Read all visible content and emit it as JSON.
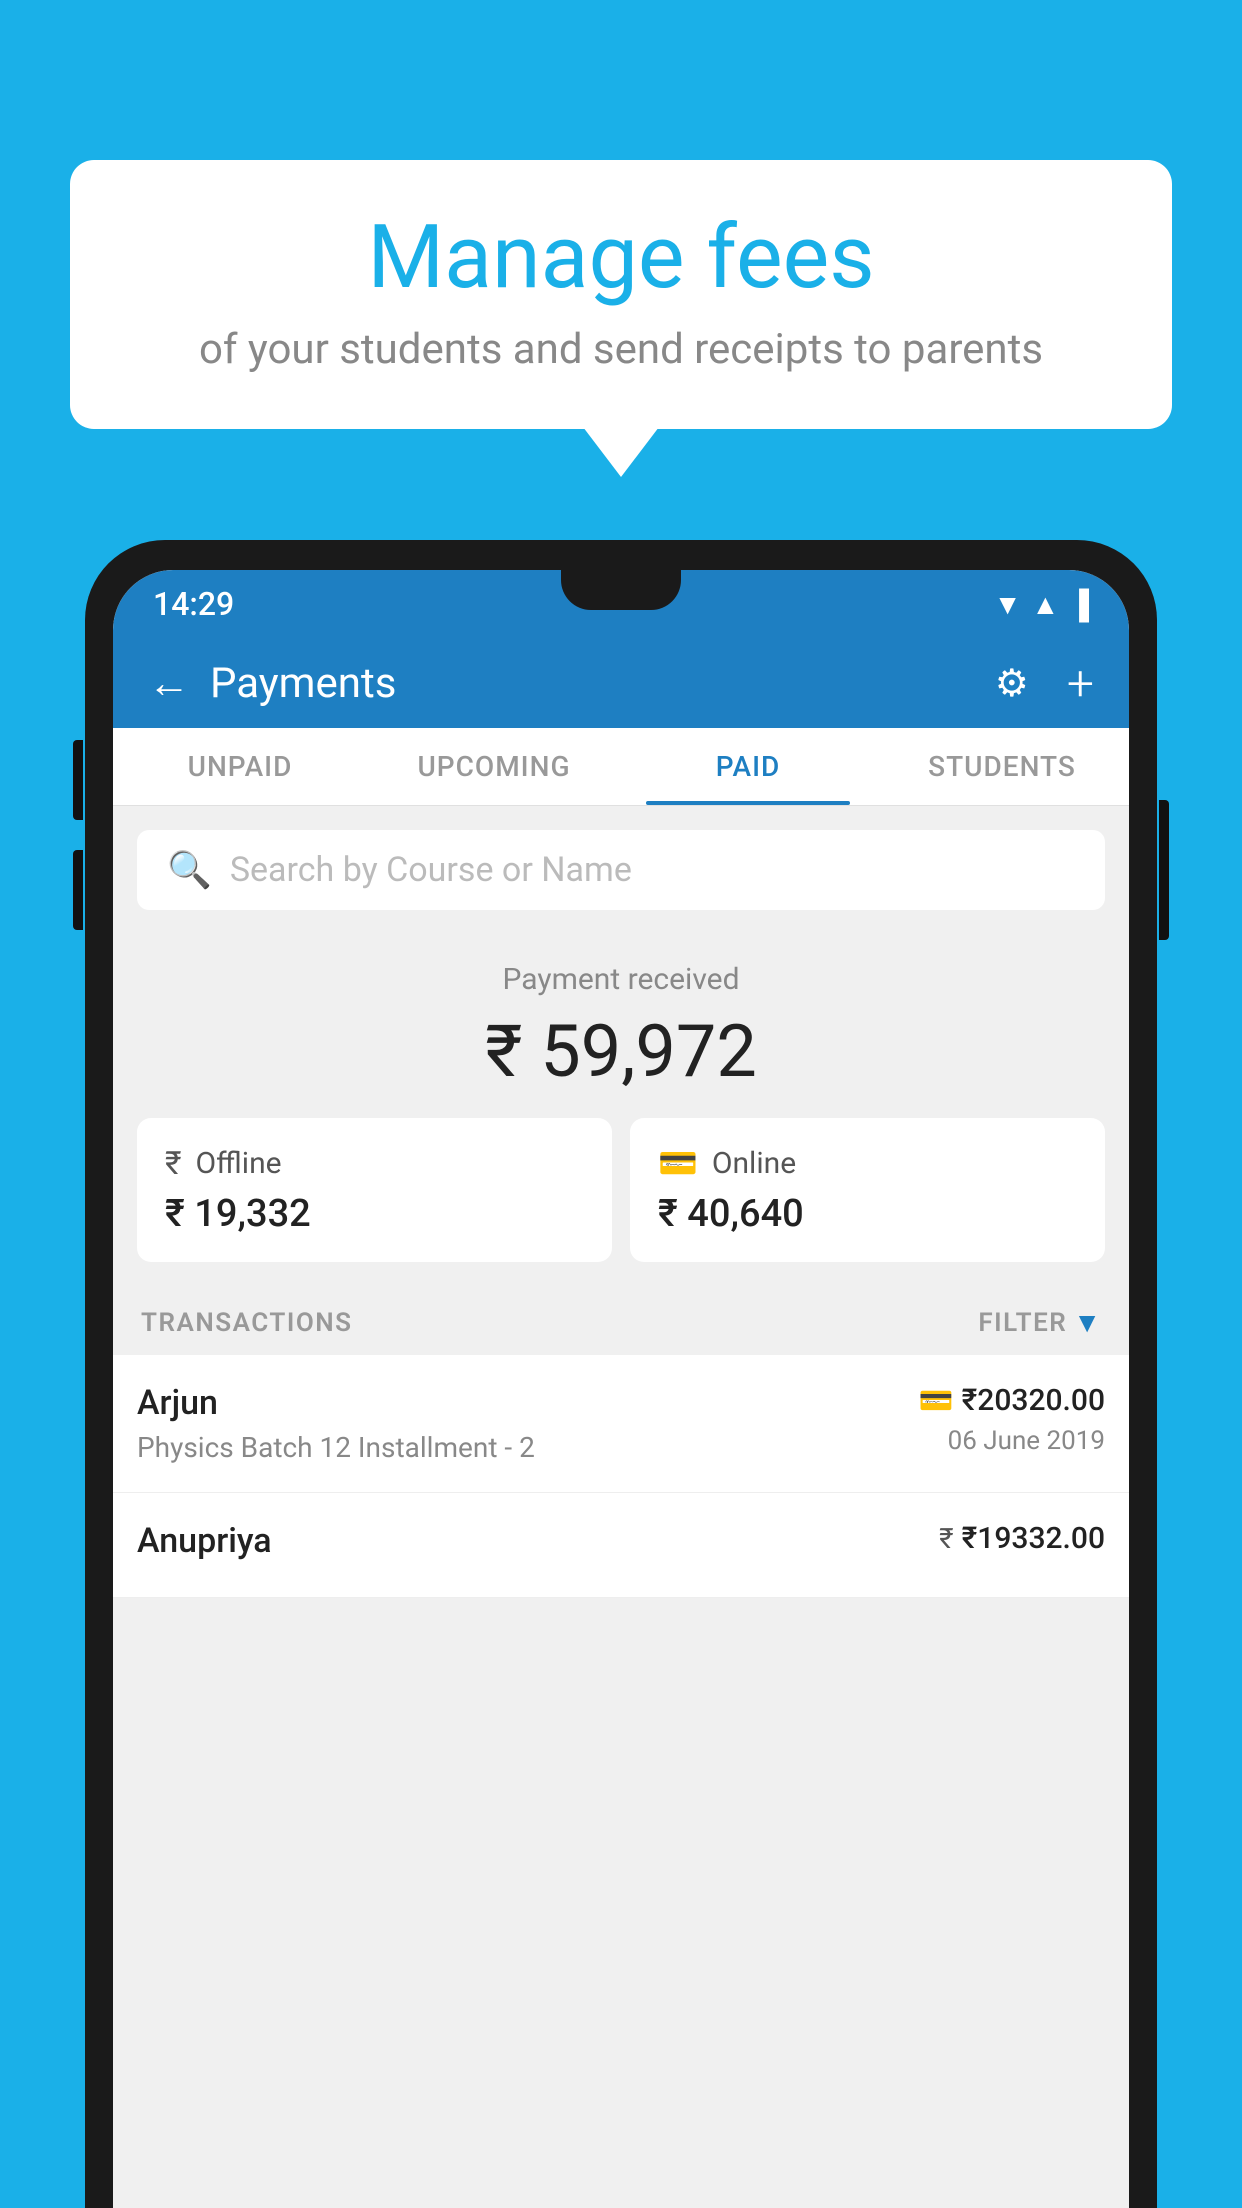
{
  "background_color": "#1ab0e8",
  "speech_bubble": {
    "main_title": "Manage fees",
    "sub_title": "of your students and send receipts to parents"
  },
  "status_bar": {
    "time": "14:29",
    "wifi": "▲",
    "signal": "▲",
    "battery": "▐"
  },
  "app_header": {
    "title": "Payments",
    "back_label": "←",
    "gear_label": "⚙",
    "plus_label": "+"
  },
  "tabs": [
    {
      "label": "UNPAID",
      "active": false
    },
    {
      "label": "UPCOMING",
      "active": false
    },
    {
      "label": "PAID",
      "active": true
    },
    {
      "label": "STUDENTS",
      "active": false
    }
  ],
  "search": {
    "placeholder": "Search by Course or Name"
  },
  "payment_received": {
    "label": "Payment received",
    "amount": "₹ 59,972"
  },
  "payment_cards": [
    {
      "type": "Offline",
      "amount": "₹ 19,332",
      "icon": "offline"
    },
    {
      "type": "Online",
      "amount": "₹ 40,640",
      "icon": "online"
    }
  ],
  "transactions_section": {
    "label": "TRANSACTIONS",
    "filter_label": "FILTER"
  },
  "transactions": [
    {
      "name": "Arjun",
      "detail": "Physics Batch 12 Installment - 2",
      "amount": "₹20320.00",
      "date": "06 June 2019",
      "payment_type": "online"
    },
    {
      "name": "Anupriya",
      "detail": "",
      "amount": "₹19332.00",
      "date": "",
      "payment_type": "offline"
    }
  ]
}
